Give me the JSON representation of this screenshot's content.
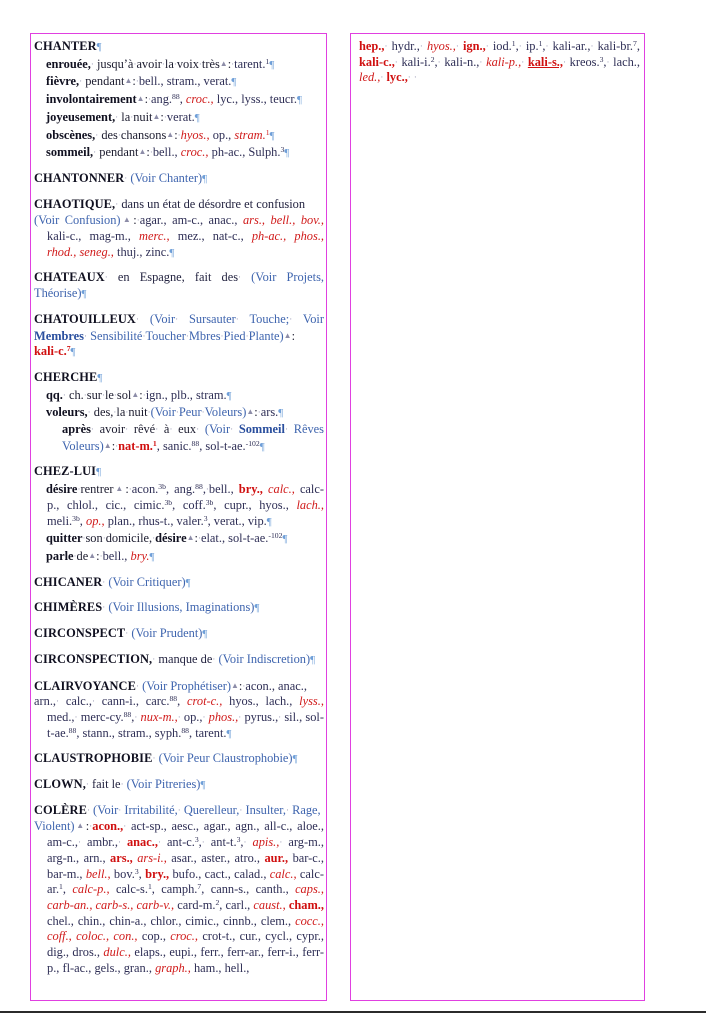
{
  "page": {
    "language": "fr",
    "kind": "homeopathic-repertory",
    "frame_color": "#e040e0",
    "colors": {
      "heading": "#101020",
      "body": "#232340",
      "cross_reference": "#3e64ae",
      "grade1": "#2e2e55",
      "grade2_italic_red": "#d01a1a",
      "grade3_bold_red": "#d01010",
      "grade4_underlined": "#d01010",
      "pilcrow": "#6f9fd8"
    }
  },
  "left_column": {
    "entries": [
      {
        "id": "chanter",
        "head": "CHANTER",
        "lines": [
          {
            "indent": 1,
            "symptom": "enrouée,",
            "text": "jusqu’à avoir la voix très: tarent.",
            "sup_after": "1"
          },
          {
            "indent": 1,
            "symptom": "fièvre,",
            "text": "pendant: bell., stram., verat."
          },
          {
            "indent": 1,
            "symptom": "involontairement",
            "text": ": ang.⁸⁸, croc., lyc., lyss., teucr."
          },
          {
            "indent": 1,
            "symptom": "joyeusement,",
            "text": "la nuit: verat."
          },
          {
            "indent": 1,
            "symptom": "obscènes,",
            "text": "des chansons: hyos., op., stram.¹"
          },
          {
            "indent": 1,
            "symptom": "sommeil,",
            "text": "pendant: bell., croc., ph-ac., Sulph.³"
          }
        ]
      },
      {
        "id": "chantonner",
        "head": "CHANTONNER",
        "xref": "(Voir Chanter)"
      },
      {
        "id": "chaotique",
        "head": "CHAOTIQUE,",
        "text": "dans un état de désordre et confusion",
        "xref": "(Voir Confusion)",
        "remedies": "agar., am-c., anac., ars., bell., bov., kali-c., mag-m., merc., mez., nat-c., ph-ac., phos., rhod., seneg., thuj., zinc."
      },
      {
        "id": "chateaux",
        "head": "CHATEAUX",
        "text": "en Espagne, fait des",
        "xref": "(Voir Projets, Théorise)"
      },
      {
        "id": "chatouilleux",
        "head": "CHATOUILLEUX",
        "xref": "(Voir Sursauter Touche; Voir Membres Sensibilité Toucher Mbres Pied Plante)",
        "remedies": "kali-c.⁷"
      },
      {
        "id": "cherche",
        "head": "CHERCHE",
        "lines": [
          {
            "indent": 1,
            "symptom": "qq.",
            "text": "ch. sur le sol: ign., plb., stram."
          },
          {
            "indent": 1,
            "symptom": "voleurs,",
            "text": "des, la nuit (Voir Peur Voleurs): ars."
          },
          {
            "indent": 2,
            "symptom": "après",
            "text": "avoir rêvé à eux (Voir Sommeil Rêves Voleurs): nat-m.¹, sanic.⁸⁸, sol-t-ae.⁻¹⁰²"
          }
        ]
      },
      {
        "id": "chez-lui",
        "head": "CHEZ-LUI",
        "lines": [
          {
            "indent": 1,
            "symptom": "désire rentrer",
            "text": ": acon.³ᵇ, ang.⁸⁸, bell., bry., calc., calc-p., chlol., cic., cimic.³ᵇ, coff.³ᵇ, cupr., hyos., lach., meli.³ᵇ, op., plan., rhus-t., valer.³, verat., vip."
          },
          {
            "indent": 1,
            "symptom": "quitter son domicile, désire",
            "text": ": elat., sol-t-ae.⁻¹⁰²"
          },
          {
            "indent": 1,
            "symptom": "parle de",
            "text": ": bell., bry."
          }
        ]
      },
      {
        "id": "chicaner",
        "head": "CHICANER",
        "xref": "(Voir Critiquer)"
      },
      {
        "id": "chimeres",
        "head": "CHIMÈRES",
        "xref": "(Voir Illusions, Imaginations)"
      },
      {
        "id": "circonspect",
        "head": "CIRCONSPECT",
        "xref": "(Voir Prudent)"
      },
      {
        "id": "circonspection",
        "head": "CIRCONSPECTION,",
        "text": "manque de",
        "xref": "(Voir Indiscretion)"
      },
      {
        "id": "clairvoyance",
        "head": "CLAIRVOYANCE",
        "xref": "(Voir Prophétiser)",
        "remedies": "acon., anac., arn., calc., cann-i., carc.⁸⁸, crot-c., hyos., lach., lyss., med., merc-cy.⁸⁸, nux-m., op., phos., pyrus., sil., sol-t-ae.⁸⁸, stann., stram., syph.⁸⁸, tarent."
      },
      {
        "id": "claustrophobie",
        "head": "CLAUSTROPHOBIE",
        "xref": "(Voir Peur Claustrophobie)"
      },
      {
        "id": "clown",
        "head": "CLOWN,",
        "text": "fait le",
        "xref": "(Voir Pitreries)"
      },
      {
        "id": "colere",
        "head": "COLÈRE",
        "xref": "(Voir Irritabilité, Querelleur, Insulter, Rage, Violent)",
        "remedies": "acon., act-sp., aesc., agar., agn., all-c., aloe., am-c., ambr., anac., ant-c.³, ant-t.³, apis., arg-m., arg-n., arn., ars., ars-i., asar., aster., atro., aur., bar-c., bar-m., bell., bov.³, bry., bufo., cact., calad., calc., calc-ar.¹, calc-p., calc-s.¹, camph.⁷, cann-s., canth., caps., carb-an., carb-s., carb-v., card-m.², carl., caust., cham., chel., chin., chin-a., chlor., cimic., cinnb., clem., cocc., coff., coloc., con., cop., croc., crot-t., cur., cycl., cypr., dig., dros., dulc., elaps., eupi., ferr., ferr-ar., ferr-i., ferr-p., fl-ac., gels., gran., graph., ham., hell.,"
      }
    ]
  },
  "right_column": {
    "continuation_of": "COLÈRE",
    "remedies": "hep., hydr., hyos., ign., iod.¹, ip.¹, kali-ar., kali-br.⁷, kali-c., kali-i.², kali-n., kali-p., kali-s., kreos.³, lach., led., lyc.,"
  }
}
